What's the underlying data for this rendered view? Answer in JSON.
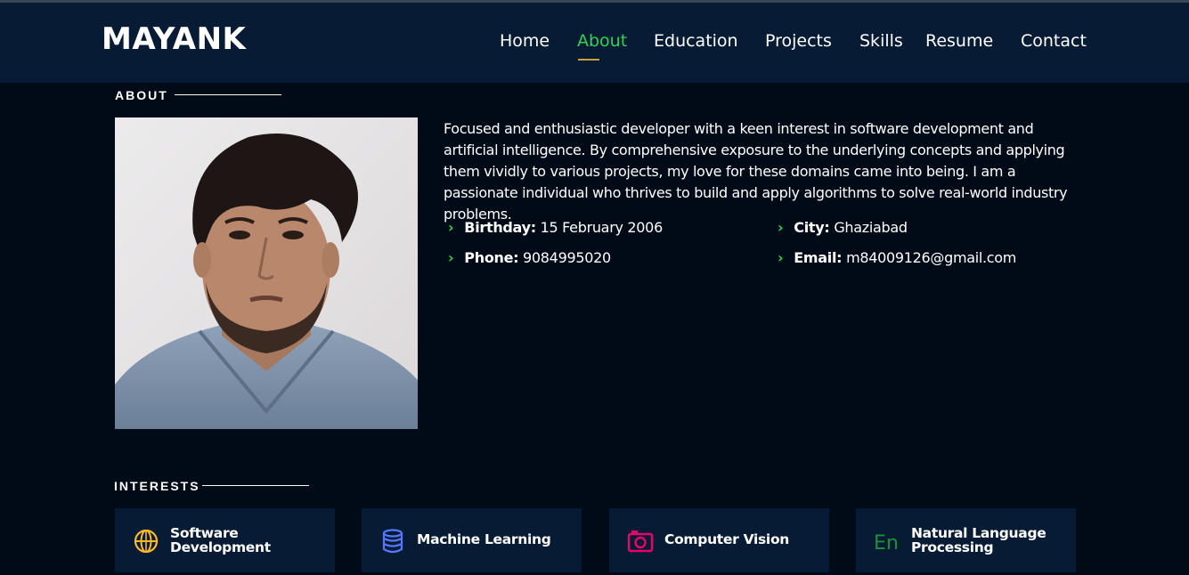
{
  "brand": "MAYANK",
  "nav": [
    {
      "label": "Home",
      "active": false
    },
    {
      "label": "About",
      "active": true
    },
    {
      "label": "Education",
      "active": false
    },
    {
      "label": "Projects",
      "active": false
    },
    {
      "label": "Skills",
      "active": false
    },
    {
      "label": "Resume",
      "active": false
    },
    {
      "label": "Contact",
      "active": false
    }
  ],
  "about": {
    "title": "ABOUT",
    "text": "Focused and enthusiastic developer with a keen interest in software development and artificial intelligence. By comprehensive exposure to the underlying concepts and applying them vividly to various projects, my love for these domains came into being. I am a passionate individual who thrives to build and apply algorithms to solve real-world industry problems.",
    "details": [
      {
        "label": "Birthday:",
        "value": "15 February 2006"
      },
      {
        "label": "City:",
        "value": "Ghaziabad"
      },
      {
        "label": "Phone:",
        "value": "9084995020"
      },
      {
        "label": "Email:",
        "value": "m84009126@gmail.com"
      }
    ]
  },
  "interests": {
    "title": "INTERESTS",
    "items": [
      {
        "label": "Software Development",
        "icon": "globe-icon",
        "color": "#ffbb2c"
      },
      {
        "label": "Machine Learning",
        "icon": "database-icon",
        "color": "#5578ff"
      },
      {
        "label": "Computer Vision",
        "icon": "camera-icon",
        "color": "#e80368"
      },
      {
        "label": "Natural Language Processing",
        "icon": "language-icon",
        "color": "#1f8f3a"
      }
    ]
  },
  "colors": {
    "accent": "#2ed352",
    "header_bg": "#081b35",
    "page_bg": "#010b17"
  }
}
